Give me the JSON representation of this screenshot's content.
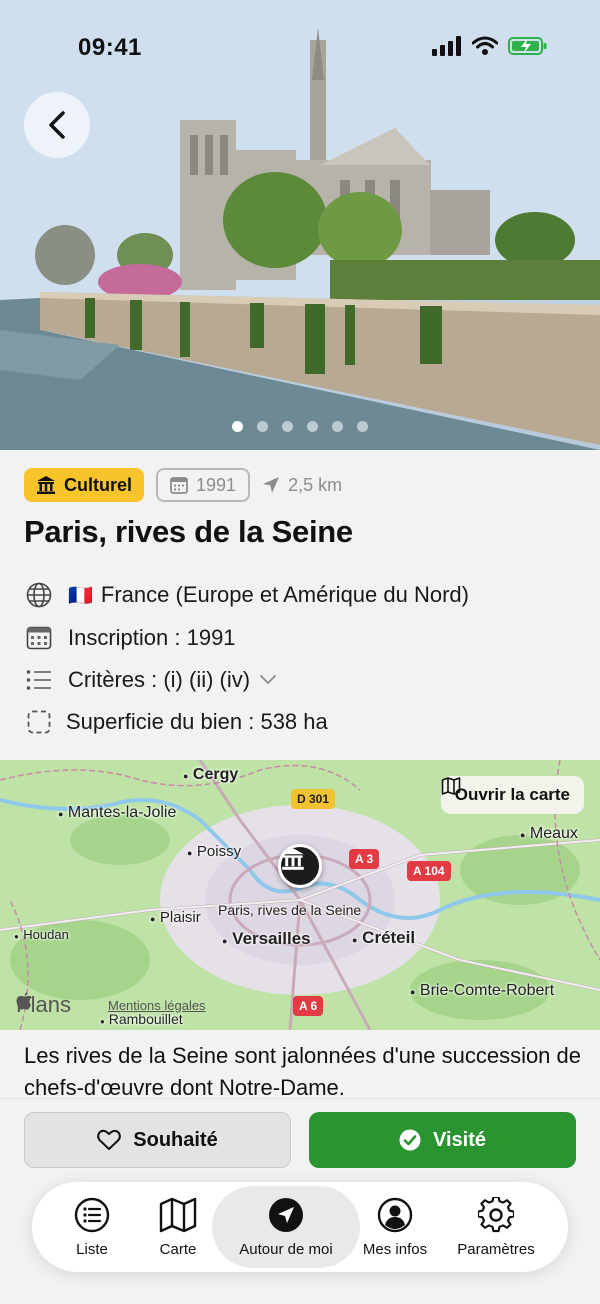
{
  "status_bar": {
    "time": "09:41"
  },
  "hero": {
    "image_alt": "Notre-Dame et rives de la Seine",
    "dots_count": 6,
    "active_dot": 0
  },
  "tags": {
    "category": "Culturel",
    "year": "1991",
    "distance": "2,5 km"
  },
  "title": "Paris, rives de la Seine",
  "info": {
    "country_flag": "🇫🇷",
    "country": "France (Europe et Amérique du Nord)",
    "inscription": "Inscription : 1991",
    "criteria": "Critères : (i) (ii) (iv)",
    "area": "Superficie du bien : 538 ha"
  },
  "map": {
    "open_label": "Ouvrir la carte",
    "site_label": "Paris, rives de la Seine",
    "plans_label": "Plans",
    "legal_label": "Mentions légales",
    "places": [
      "Cergy",
      "Mantes-la-Jolie",
      "Poissy",
      "Meaux",
      "Plaisir",
      "Houdan",
      "Versailles",
      "Créteil",
      "Brie-Comte-Robert",
      "Rambouillet"
    ],
    "roads": [
      "D 301",
      "A 3",
      "A 104",
      "A 6"
    ]
  },
  "description": "Les rives de la Seine sont jalonnées d'une succession de chefs-d'œuvre dont Notre-Dame.",
  "actions": {
    "wish_label": "Souhaité",
    "visited_label": "Visité"
  },
  "tabs": [
    {
      "label": "Liste",
      "icon": "list-icon"
    },
    {
      "label": "Carte",
      "icon": "map-icon"
    },
    {
      "label": "Autour de moi",
      "icon": "location-arrow-icon",
      "active": true
    },
    {
      "label": "Mes infos",
      "icon": "person-icon"
    },
    {
      "label": "Paramètres",
      "icon": "gear-icon"
    }
  ],
  "colors": {
    "accent_green": "#2a9431",
    "category_yellow": "#f7c52b"
  }
}
